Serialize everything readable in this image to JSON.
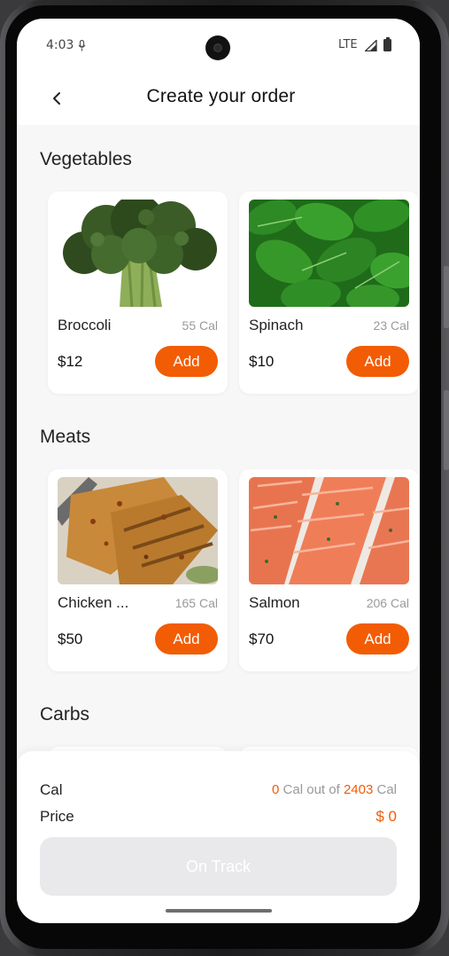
{
  "status_bar": {
    "time": "4:03",
    "network": "LTE"
  },
  "header": {
    "title": "Create your order"
  },
  "sections": [
    {
      "title": "Vegetables",
      "items": [
        {
          "name": "Broccoli",
          "calories": "55 Cal",
          "price": "$12",
          "add_label": "Add"
        },
        {
          "name": "Spinach",
          "calories": "23 Cal",
          "price": "$10",
          "add_label": "Add"
        }
      ]
    },
    {
      "title": "Meats",
      "items": [
        {
          "name": "Chicken ...",
          "calories": "165 Cal",
          "price": "$50",
          "add_label": "Add"
        },
        {
          "name": "Salmon",
          "calories": "206 Cal",
          "price": "$70",
          "add_label": "Add"
        }
      ]
    },
    {
      "title": "Carbs",
      "items": []
    }
  ],
  "summary": {
    "cal_label": "Cal",
    "cal_current": "0",
    "cal_mid": " Cal out of ",
    "cal_target": "2403",
    "cal_unit": " Cal",
    "price_label": "Price",
    "price_value": "$ 0",
    "button_label": "On Track"
  },
  "colors": {
    "accent": "#f25c05",
    "disabled_button": "#e9e9ec",
    "background": "#f7f7f8"
  },
  "icons": [
    "back-arrow-icon",
    "mic-icon",
    "signal-icon",
    "battery-icon"
  ]
}
